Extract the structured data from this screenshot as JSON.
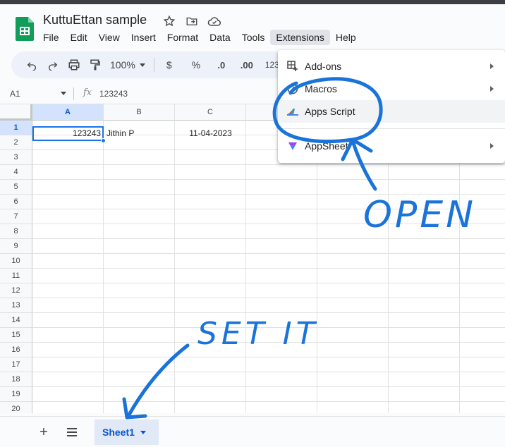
{
  "app": {
    "doc_title": "KuttuEttan sample",
    "menus": [
      "File",
      "Edit",
      "View",
      "Insert",
      "Format",
      "Data",
      "Tools",
      "Extensions",
      "Help"
    ],
    "active_menu": "Extensions"
  },
  "toolbar": {
    "zoom": "100%",
    "currency": "$",
    "percent": "%",
    "decrease_decimal": ".0",
    "increase_decimal": ".00",
    "number_format": "123"
  },
  "formula_bar": {
    "name_box": "A1",
    "fx": "fx",
    "value": "123243"
  },
  "grid": {
    "columns": [
      "A",
      "B",
      "C"
    ],
    "rows": [
      "1",
      "2",
      "3",
      "4",
      "5",
      "6",
      "7",
      "8",
      "9",
      "10",
      "11",
      "12",
      "13",
      "14",
      "15",
      "16",
      "17",
      "18",
      "19",
      "20"
    ],
    "cells": {
      "A1": "123243",
      "B1": "Jithin P",
      "C1": "11-04-2023"
    }
  },
  "sheets": {
    "add_label": "+",
    "tabs": [
      "Sheet1"
    ]
  },
  "extensions_menu": {
    "items": [
      "Add-ons",
      "Macros",
      "Apps Script",
      "AppSheet"
    ]
  },
  "annotations": {
    "open": "OPEN",
    "set_it": "SET IT"
  },
  "colors": {
    "accent": "#0b57d0",
    "selection": "#1a73e8",
    "annotation": "#1a73d9"
  }
}
